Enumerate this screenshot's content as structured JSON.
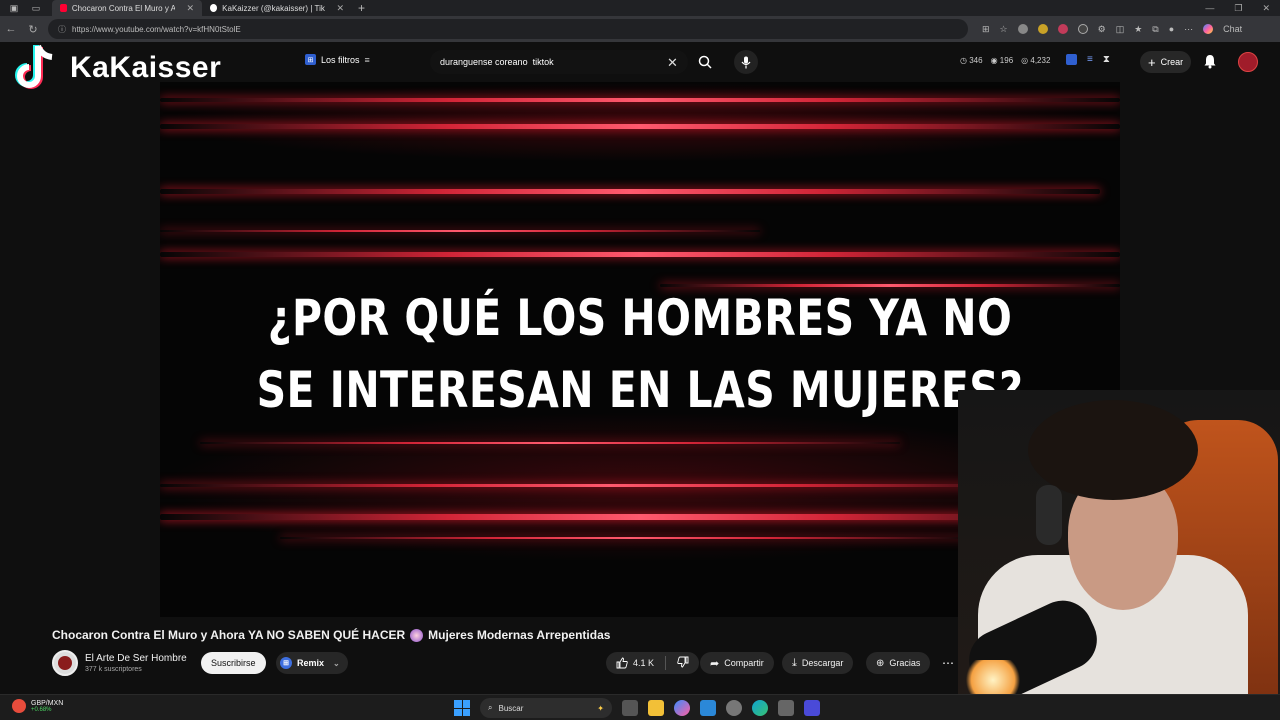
{
  "browser": {
    "tabs": [
      {
        "label": "Chocaron Contra El Muro y Ahora",
        "active": true,
        "favicon_color": "#ff0033"
      },
      {
        "label": "KaKaizzer (@kakaisser) | TikTok",
        "active": false,
        "favicon_color": "#ffffff"
      }
    ],
    "url": "https://www.youtube.com/watch?v=kfHN0tStolE",
    "chat_label": "Chat"
  },
  "overlay": {
    "channel_name": "KaKaisser"
  },
  "header": {
    "filters_label": "Los filtros",
    "search_value": "duranguense coreano  tiktok",
    "stats": [
      "346",
      "196",
      "4,232"
    ],
    "create_label": "Crear"
  },
  "video": {
    "headline_line1": "¿POR QUÉ LOS HOMBRES YA NO",
    "headline_line2": "SE INTERESAN EN LAS MUJERES?",
    "title_part1": "Chocaron Contra El Muro y Ahora YA NO SABEN QUÉ HACER",
    "title_part2": "Mujeres Modernas Arrepentidas",
    "channel": "El Arte De Ser Hombre",
    "subscribers": "377 k suscriptores",
    "subscribe_label": "Suscribirse",
    "remix_label": "Remix",
    "likes": "4.1 K",
    "share_label": "Compartir",
    "download_label": "Descargar",
    "thanks_label": "Gracias"
  },
  "taskbar": {
    "ticker_pair": "GBP/MXN",
    "ticker_change": "+0.68%",
    "search_placeholder": "Buscar"
  },
  "colors": {
    "streak": "#e8283c",
    "accent_blue": "#3e6fe0",
    "yt_bg": "#0f0f0f"
  }
}
